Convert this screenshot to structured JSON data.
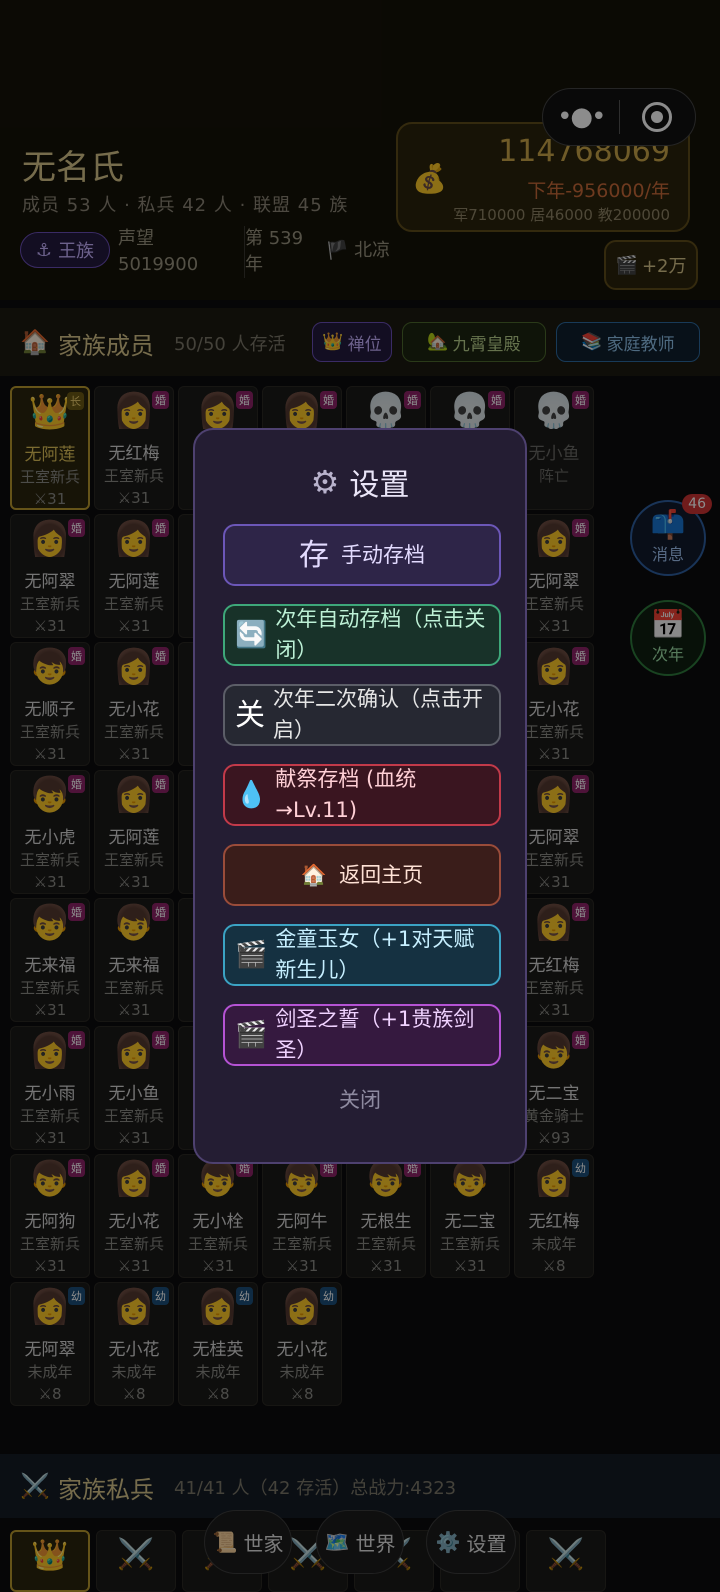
{
  "family": {
    "name": "无名氏",
    "stats": "成员 53 人 · 私兵 42 人 · 联盟 45 族",
    "royal_badge": "王族",
    "prestige_label": "声望",
    "prestige_value": "5019900",
    "year_line1": "第 539",
    "year_line2": "年",
    "location": "北凉"
  },
  "money": {
    "total": "114768069",
    "next_year": "下年-956000/年",
    "breakdown": "军710000 居46000 教200000"
  },
  "ad_button": "+2万",
  "members_section": {
    "title": "家族成员",
    "count": "50/50 人存活",
    "chips": [
      "禅位",
      "九霄皇殿",
      "家庭教师"
    ]
  },
  "members": [
    {
      "emoji": "👑",
      "tag": "长",
      "tag_type": "l",
      "name": "无阿莲",
      "rank": "王室新兵",
      "level": "⚔31",
      "leader": true
    },
    {
      "emoji": "👩",
      "tag": "婚",
      "tag_type": "m",
      "name": "无红梅",
      "rank": "王室新兵",
      "level": "⚔31"
    },
    {
      "emoji": "👩",
      "tag": "婚",
      "tag_type": "m",
      "name": "",
      "rank": "",
      "level": ""
    },
    {
      "emoji": "👩",
      "tag": "婚",
      "tag_type": "m",
      "name": "",
      "rank": "",
      "level": ""
    },
    {
      "emoji": "💀",
      "tag": "婚",
      "tag_type": "m",
      "name": "",
      "rank": "",
      "level": "",
      "dead": true
    },
    {
      "emoji": "💀",
      "tag": "婚",
      "tag_type": "m",
      "name": "",
      "rank": "",
      "level": "",
      "dead": true
    },
    {
      "emoji": "💀",
      "tag": "婚",
      "tag_type": "m",
      "name": "无小鱼",
      "rank": "阵亡",
      "level": "",
      "dead": true
    },
    {
      "emoji": "👩",
      "tag": "婚",
      "tag_type": "m",
      "name": "无阿翠",
      "rank": "王室新兵",
      "level": "⚔31"
    },
    {
      "emoji": "👩",
      "tag": "婚",
      "tag_type": "m",
      "name": "无阿莲",
      "rank": "王室新兵",
      "level": "⚔31"
    },
    {
      "emoji": "",
      "tag": "",
      "name": "",
      "rank": "",
      "level": ""
    },
    {
      "emoji": "",
      "tag": "",
      "name": "",
      "rank": "",
      "level": ""
    },
    {
      "emoji": "",
      "tag": "",
      "name": "",
      "rank": "",
      "level": ""
    },
    {
      "emoji": "",
      "tag": "",
      "name": "",
      "rank": "",
      "level": ""
    },
    {
      "emoji": "👩",
      "tag": "婚",
      "tag_type": "m",
      "name": "无阿翠",
      "rank": "王室新兵",
      "level": "⚔31"
    },
    {
      "emoji": "👦",
      "tag": "婚",
      "tag_type": "m",
      "name": "无顺子",
      "rank": "王室新兵",
      "level": "⚔31"
    },
    {
      "emoji": "👩",
      "tag": "婚",
      "tag_type": "m",
      "name": "无小花",
      "rank": "王室新兵",
      "level": "⚔31"
    },
    {
      "emoji": "",
      "tag": "",
      "name": "",
      "rank": "",
      "level": ""
    },
    {
      "emoji": "",
      "tag": "",
      "name": "",
      "rank": "",
      "level": ""
    },
    {
      "emoji": "",
      "tag": "",
      "name": "",
      "rank": "",
      "level": ""
    },
    {
      "emoji": "",
      "tag": "",
      "name": "",
      "rank": "",
      "level": ""
    },
    {
      "emoji": "👩",
      "tag": "婚",
      "tag_type": "m",
      "name": "无小花",
      "rank": "王室新兵",
      "level": "⚔31"
    },
    {
      "emoji": "👦",
      "tag": "婚",
      "tag_type": "m",
      "name": "无小虎",
      "rank": "王室新兵",
      "level": "⚔31"
    },
    {
      "emoji": "👩",
      "tag": "婚",
      "tag_type": "m",
      "name": "无阿莲",
      "rank": "王室新兵",
      "level": "⚔31"
    },
    {
      "emoji": "",
      "tag": "",
      "name": "",
      "rank": "",
      "level": ""
    },
    {
      "emoji": "",
      "tag": "",
      "name": "",
      "rank": "",
      "level": ""
    },
    {
      "emoji": "",
      "tag": "",
      "name": "",
      "rank": "",
      "level": ""
    },
    {
      "emoji": "",
      "tag": "",
      "name": "",
      "rank": "",
      "level": ""
    },
    {
      "emoji": "👩",
      "tag": "婚",
      "tag_type": "m",
      "name": "无阿翠",
      "rank": "王室新兵",
      "level": "⚔31"
    },
    {
      "emoji": "👦",
      "tag": "婚",
      "tag_type": "m",
      "name": "无来福",
      "rank": "王室新兵",
      "level": "⚔31"
    },
    {
      "emoji": "👦",
      "tag": "婚",
      "tag_type": "m",
      "name": "无来福",
      "rank": "王室新兵",
      "level": "⚔31"
    },
    {
      "emoji": "",
      "tag": "",
      "name": "",
      "rank": "",
      "level": ""
    },
    {
      "emoji": "",
      "tag": "",
      "name": "",
      "rank": "",
      "level": ""
    },
    {
      "emoji": "",
      "tag": "",
      "name": "",
      "rank": "",
      "level": ""
    },
    {
      "emoji": "",
      "tag": "",
      "name": "",
      "rank": "",
      "level": ""
    },
    {
      "emoji": "👩",
      "tag": "婚",
      "tag_type": "m",
      "name": "无红梅",
      "rank": "王室新兵",
      "level": "⚔31"
    },
    {
      "emoji": "👩",
      "tag": "婚",
      "tag_type": "m",
      "name": "无小雨",
      "rank": "王室新兵",
      "level": "⚔31"
    },
    {
      "emoji": "👩",
      "tag": "婚",
      "tag_type": "m",
      "name": "无小鱼",
      "rank": "王室新兵",
      "level": "⚔31"
    },
    {
      "emoji": "",
      "tag": "",
      "name": "",
      "rank": "",
      "level": ""
    },
    {
      "emoji": "",
      "tag": "",
      "name": "",
      "rank": "",
      "level": ""
    },
    {
      "emoji": "",
      "tag": "",
      "name": "",
      "rank": "",
      "level": ""
    },
    {
      "emoji": "",
      "tag": "",
      "name": "",
      "rank": "",
      "level": ""
    },
    {
      "emoji": "👦",
      "tag": "婚",
      "tag_type": "m",
      "name": "无二宝",
      "rank": "黄金骑士",
      "level": "⚔93"
    },
    {
      "emoji": "👦",
      "tag": "婚",
      "tag_type": "m",
      "name": "无阿狗",
      "rank": "王室新兵",
      "level": "⚔31"
    },
    {
      "emoji": "👩",
      "tag": "婚",
      "tag_type": "m",
      "name": "无小花",
      "rank": "王室新兵",
      "level": "⚔31"
    },
    {
      "emoji": "👦",
      "tag": "婚",
      "tag_type": "m",
      "name": "无小栓",
      "rank": "王室新兵",
      "level": "⚔31"
    },
    {
      "emoji": "👦",
      "tag": "婚",
      "tag_type": "m",
      "name": "无阿牛",
      "rank": "王室新兵",
      "level": "⚔31"
    },
    {
      "emoji": "👦",
      "tag": "婚",
      "tag_type": "m",
      "name": "无根生",
      "rank": "王室新兵",
      "level": "⚔31"
    },
    {
      "emoji": "👦",
      "tag": "",
      "name": "无二宝",
      "rank": "王室新兵",
      "level": "⚔31"
    },
    {
      "emoji": "👩",
      "tag": "幼",
      "tag_type": "y",
      "name": "无红梅",
      "rank": "未成年",
      "level": "⚔8"
    },
    {
      "emoji": "👩",
      "tag": "幼",
      "tag_type": "y",
      "name": "无阿翠",
      "rank": "未成年",
      "level": "⚔8"
    },
    {
      "emoji": "👩",
      "tag": "幼",
      "tag_type": "y",
      "name": "无小花",
      "rank": "未成年",
      "level": "⚔8"
    },
    {
      "emoji": "👩",
      "tag": "幼",
      "tag_type": "y",
      "name": "无桂英",
      "rank": "未成年",
      "level": "⚔8"
    },
    {
      "emoji": "👩",
      "tag": "幼",
      "tag_type": "y",
      "name": "无小花",
      "rank": "未成年",
      "level": "⚔8"
    }
  ],
  "floating": {
    "message_label": "消息",
    "message_count": "46",
    "next_year_label": "次年"
  },
  "army_section": {
    "title": "家族私兵",
    "count": "41/41 人（42 存活）总战力:4323"
  },
  "bottom_nav": [
    "世家",
    "世界",
    "设置"
  ],
  "settings_modal": {
    "title": "设置",
    "manual_save_icon": "存",
    "manual_save": "手动存档",
    "auto_save": "次年自动存档（点击关闭）",
    "double_confirm_icon": "关",
    "double_confirm": "次年二次确认（点击开启）",
    "blood_save": "献祭存档 (血统→Lv.11)",
    "home": "返回主页",
    "ad_reward_1": "金童玉女（+1对天赋新生儿）",
    "ad_reward_2": "剑圣之誓（+1贵族剑圣）",
    "close": "关闭"
  }
}
